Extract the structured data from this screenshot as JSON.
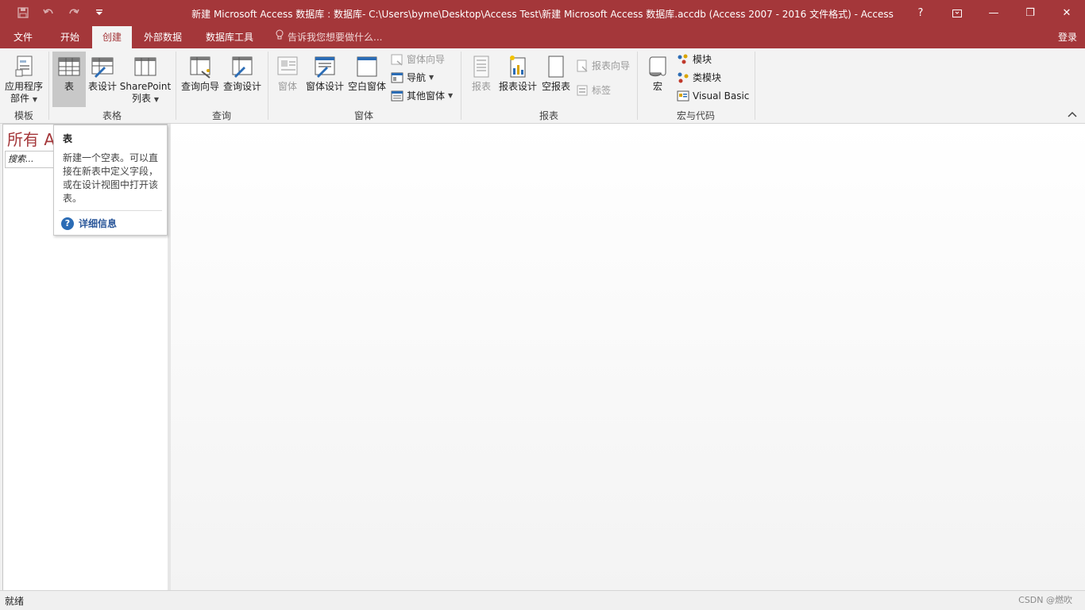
{
  "window": {
    "title": "新建 Microsoft Access 数据库 : 数据库- C:\\Users\\byme\\Desktop\\Access Test\\新建 Microsoft Access 数据库.accdb (Access 2007 - 2016 文件格式) - Access",
    "help_label": "?",
    "minimize_label": "—",
    "restore_label": "❐",
    "close_label": "✕"
  },
  "tabs": [
    {
      "label": "文件"
    },
    {
      "label": "开始"
    },
    {
      "label": "创建"
    },
    {
      "label": "外部数据"
    },
    {
      "label": "数据库工具"
    }
  ],
  "tell_me": "告诉我您想要做什么...",
  "sign_in": "登录",
  "ribbon": {
    "groups": {
      "templates": "模板",
      "tables": "表格",
      "queries": "查询",
      "forms": "窗体",
      "reports": "报表",
      "macros": "宏与代码"
    },
    "app_parts": [
      "应用程序",
      "部件"
    ],
    "table": "表",
    "table_design": "表设计",
    "sharepoint": [
      "SharePoint",
      "列表"
    ],
    "query_wizard": "查询向导",
    "query_design": "查询设计",
    "form": "窗体",
    "form_design": "窗体设计",
    "blank_form": "空白窗体",
    "form_wizard": "窗体向导",
    "navigation": "导航",
    "more_forms": "其他窗体",
    "report": "报表",
    "report_design": "报表设计",
    "blank_report": "空报表",
    "report_wizard": "报表向导",
    "labels": "标签",
    "macro": "宏",
    "module": "模块",
    "class_module": "类模块",
    "visual_basic": "Visual Basic"
  },
  "nav_pane": {
    "title": "所有 A",
    "search_placeholder": "搜索..."
  },
  "tooltip": {
    "title": "表",
    "body": "新建一个空表。可以直接在新表中定义字段，或在设计视图中打开该表。",
    "more_info": "详细信息"
  },
  "status": {
    "text": "就绪",
    "watermark": "CSDN @燃吹"
  },
  "colors": {
    "accent": "#a4373a",
    "ribbon_bg": "#f3f3f3",
    "link": "#2b579a"
  }
}
